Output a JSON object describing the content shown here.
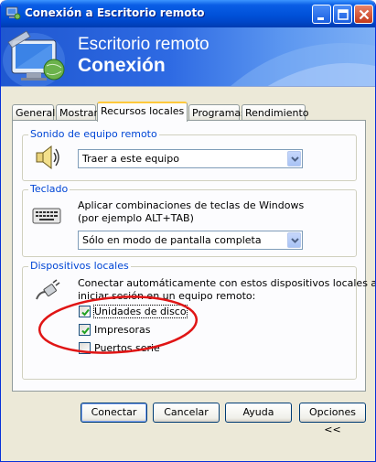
{
  "window": {
    "title": "Conexión a Escritorio remoto"
  },
  "banner": {
    "line1": "Escritorio remoto",
    "line2": "Conexión"
  },
  "tabs": [
    {
      "label": "General",
      "active": false
    },
    {
      "label": "Mostrar",
      "active": false
    },
    {
      "label": "Recursos locales",
      "active": true
    },
    {
      "label": "Programas",
      "active": false
    },
    {
      "label": "Rendimiento",
      "active": false
    }
  ],
  "sound": {
    "group_title": "Sonido de equipo remoto",
    "selected": "Traer a este equipo",
    "icon": "speaker-icon"
  },
  "keyboard": {
    "group_title": "Teclado",
    "description_line1": "Aplicar combinaciones de teclas de Windows",
    "description_line2": "(por ejemplo ALT+TAB)",
    "selected": "Sólo en modo de pantalla completa",
    "icon": "keyboard-icon"
  },
  "devices": {
    "group_title": "Dispositivos locales",
    "description_line1": "Conectar automáticamente con estos dispositivos locales al",
    "description_line2": "iniciar sesión en un equipo remoto:",
    "icon": "plug-icon",
    "items": [
      {
        "label": "Unidades de disco",
        "checked": true
      },
      {
        "label": "Impresoras",
        "checked": true
      },
      {
        "label": "Puertos serie",
        "checked": false
      }
    ]
  },
  "buttons": {
    "connect": "Conectar",
    "cancel": "Cancelar",
    "help": "Ayuda",
    "options": "Opciones <<"
  },
  "colors": {
    "title_bar": "#0051d9",
    "group_title": "#0046d5",
    "annotation_ellipse": "#e01515",
    "dialog_bg": "#ece9d8"
  }
}
